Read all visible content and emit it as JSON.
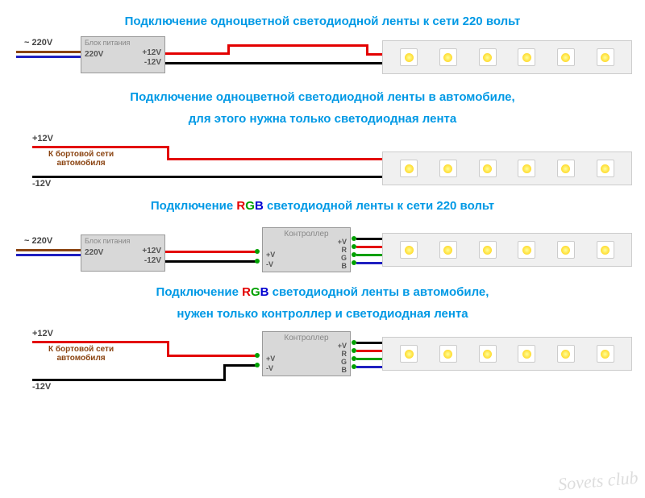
{
  "titles": {
    "t1": "Подключение одноцветной светодиодной ленты к сети 220 вольт",
    "t2a": "Подключение одноцветной светодиодной ленты в автомобиле,",
    "t2b": "для этого нужна только светодиодная лента",
    "t3a": "Подключение ",
    "t3b": " светодиодной ленты к сети 220 вольт",
    "t4a": "Подключение ",
    "t4b": " светодиодной ленты в автомобиле,",
    "t4c": "нужен только контроллер и светодиодная лента",
    "rgb_r": "R",
    "rgb_g": "G",
    "rgb_b": "B"
  },
  "labels": {
    "psu_title": "Блок питания",
    "psu_220": "220V",
    "tilde_220": "~ 220V",
    "p12": "+12V",
    "m12": "-12V",
    "car": "К бортовой сети\nавтомобиля",
    "controller": "Контроллер",
    "pv": "+V",
    "mv": "-V",
    "cpv": "+V",
    "cr": "R",
    "cg": "G",
    "cb": "B"
  },
  "watermark": "Sovets club"
}
